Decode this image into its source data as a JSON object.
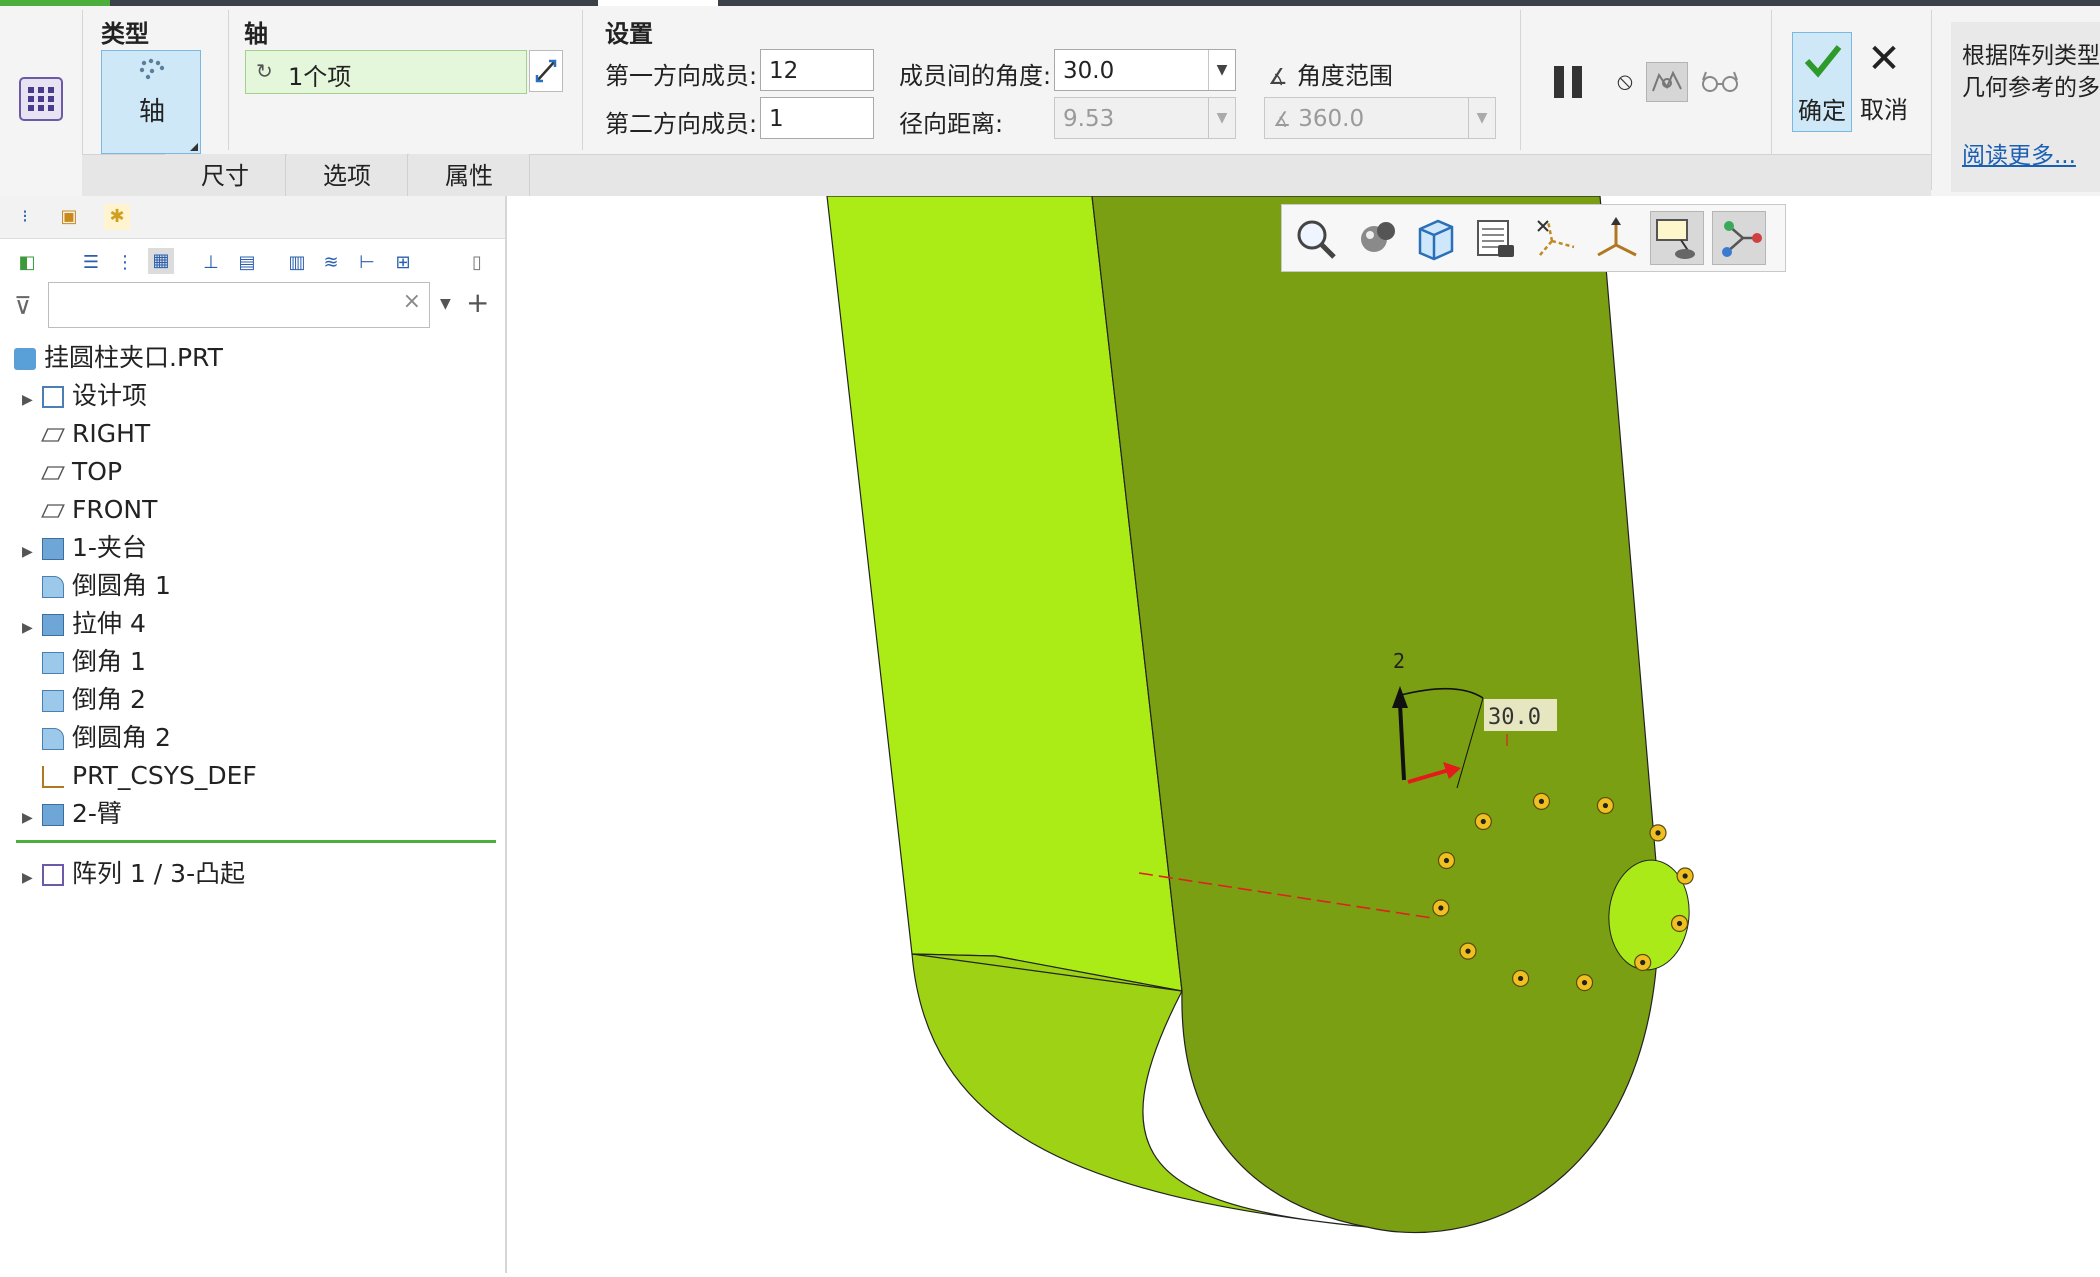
{
  "ribbon": {
    "type": {
      "title": "类型",
      "selected_label": "轴"
    },
    "axis": {
      "title": "轴",
      "value": "1个项"
    },
    "settings": {
      "title": "设置",
      "first_dir_label": "第一方向成员:",
      "first_dir_value": "12",
      "second_dir_label": "第二方向成员:",
      "second_dir_value": "1",
      "angle_between_label": "成员间的角度:",
      "angle_between_value": "30.0",
      "radial_distance_label": "径向距离:",
      "radial_distance_value": "9.53",
      "angle_range_label": "角度范围",
      "angle_range_value": "360.0"
    },
    "ok_label": "确定",
    "cancel_label": "取消",
    "tabs": [
      "尺寸",
      "选项",
      "属性"
    ],
    "tip": {
      "line1": "根据阵列类型",
      "line2": "几何参考的多",
      "read_more": "阅读更多..."
    }
  },
  "tree": {
    "root": "挂圆柱夹口.PRT",
    "items": [
      {
        "label": "设计项",
        "expandable": true,
        "icon": "design-items-icon"
      },
      {
        "label": "RIGHT",
        "expandable": false,
        "icon": "datum-plane-icon"
      },
      {
        "label": "TOP",
        "expandable": false,
        "icon": "datum-plane-icon"
      },
      {
        "label": "FRONT",
        "expandable": false,
        "icon": "datum-plane-icon"
      },
      {
        "label": "1-夹台",
        "expandable": true,
        "icon": "extrude-icon"
      },
      {
        "label": "倒圆角 1",
        "expandable": false,
        "icon": "round-icon"
      },
      {
        "label": "拉伸 4",
        "expandable": true,
        "icon": "extrude-icon"
      },
      {
        "label": "倒角 1",
        "expandable": false,
        "icon": "chamfer-icon"
      },
      {
        "label": "倒角 2",
        "expandable": false,
        "icon": "chamfer-icon"
      },
      {
        "label": "倒圆角 2",
        "expandable": false,
        "icon": "round-icon"
      },
      {
        "label": "PRT_CSYS_DEF",
        "expandable": false,
        "icon": "csys-icon"
      },
      {
        "label": "2-臂",
        "expandable": true,
        "icon": "extrude-icon"
      }
    ],
    "pattern_item": "阵列 1 / 3-凸起",
    "search_placeholder": ""
  },
  "viewport": {
    "dim_label_top": "2",
    "dim_angle": "30.0"
  },
  "colors": {
    "part_face": "#7b9e10",
    "part_side": "#a9e314",
    "accent_green": "#4caf3c"
  }
}
